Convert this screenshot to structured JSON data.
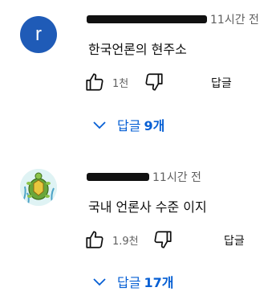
{
  "comments": [
    {
      "avatar_letter": "r",
      "time": "11시간 전",
      "text": "한국언론의 현주소",
      "like_count": "1천",
      "reply_label": "답글",
      "replies_prefix": "답글",
      "replies_count": "9개",
      "avatar_color": "#1f5bb7"
    },
    {
      "avatar_icon": "turtle-avatar-icon",
      "time": "11시간 전",
      "text": "국내 언론사 수준 이지",
      "like_count": "1.9천",
      "reply_label": "답글",
      "replies_prefix": "답글",
      "replies_count": "17개"
    }
  ],
  "colors": {
    "accent": "#065fd4",
    "muted": "#606060",
    "text": "#0f0f0f"
  }
}
